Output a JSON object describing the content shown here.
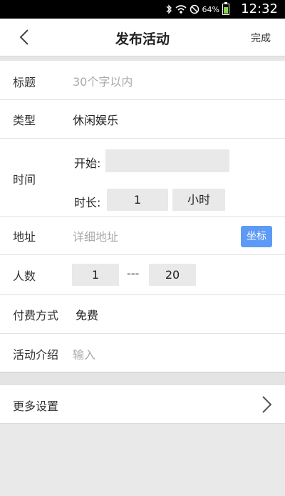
{
  "statusbar": {
    "battery_percent": "64%",
    "time": "12:32",
    "icons": [
      "bluetooth-icon",
      "wifi-icon",
      "do-not-disturb-icon",
      "battery-icon"
    ]
  },
  "header": {
    "title": "发布活动",
    "done_label": "完成"
  },
  "form": {
    "title": {
      "label": "标题",
      "placeholder": "30个字以内"
    },
    "type": {
      "label": "类型",
      "value": "休闲娱乐"
    },
    "time": {
      "label": "时间",
      "start_label": "开始:",
      "start_value": "",
      "duration_label": "时长:",
      "duration_value": "1",
      "unit": "小时"
    },
    "address": {
      "label": "地址",
      "placeholder": "详细地址",
      "coord_button": "坐标"
    },
    "count": {
      "label": "人数",
      "min": "1",
      "separator": "---",
      "max": "20"
    },
    "payment": {
      "label": "付费方式",
      "value": "免费"
    },
    "intro": {
      "label": "活动介绍",
      "placeholder": "输入"
    }
  },
  "more_settings": {
    "label": "更多设置"
  },
  "colors": {
    "accent": "#5d9af6",
    "battery": "#8bd24a"
  }
}
